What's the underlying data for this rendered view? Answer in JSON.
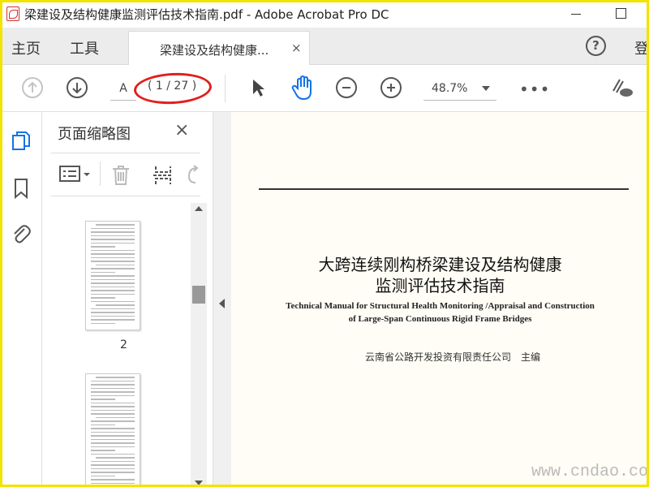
{
  "window": {
    "title": "梁建设及结构健康监测评估技术指南.pdf - Adobe Acrobat Pro DC"
  },
  "menu": {
    "home": "主页",
    "tools": "工具",
    "doc_tab": "梁建设及结构健康...",
    "doc_tab_close": "×",
    "help": "?",
    "sign_in": "登"
  },
  "toolbar": {
    "page_input": "A",
    "page_count": "( 1 / 27 )",
    "zoom": "48.7%",
    "more": "•••"
  },
  "thumbnails": {
    "panel_title": "页面缩略图",
    "close": "×",
    "pages": [
      {
        "number": "2"
      },
      {
        "number": ""
      }
    ]
  },
  "document": {
    "title_zh_line1": "大跨连续刚构桥梁建设及结构健康",
    "title_zh_line2": "监测评估技术指南",
    "title_en_line1": "Technical Manual for Structural Health Monitoring /Appraisal and Construction",
    "title_en_line2": "of Large-Span Continuous Rigid Frame Bridges",
    "publisher": "云南省公路开发投资有限责任公司　主编"
  },
  "watermark": "www.cndao.com",
  "colors": {
    "frame": "#f2e300",
    "annotation_red": "#e02020",
    "accent_blue": "#1473e6"
  }
}
